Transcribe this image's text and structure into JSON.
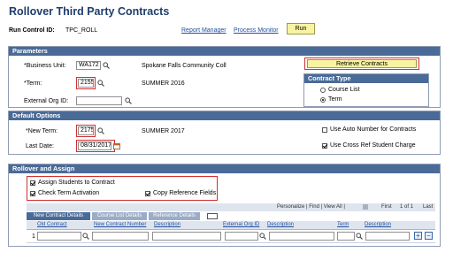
{
  "page": {
    "title": "Rollover Third Party Contracts",
    "run_control_label": "Run Control ID:",
    "run_control_value": "TPC_ROLL",
    "report_manager": "Report Manager",
    "process_monitor": "Process Monitor",
    "run_button": "Run"
  },
  "parameters": {
    "header": "Parameters",
    "business_unit_label": "*Business Unit:",
    "business_unit_value": "WA172",
    "business_unit_desc": "Spokane Falls Community Coll",
    "term_label": "*Term:",
    "term_value": "2155",
    "term_desc": "SUMMER 2016",
    "external_org_label": "External Org ID:",
    "external_org_value": "",
    "retrieve_button": "Retrieve Contracts",
    "contract_type": {
      "header": "Contract Type",
      "options": [
        "Course List",
        "Term"
      ],
      "selected": "Term"
    }
  },
  "default_options": {
    "header": "Default Options",
    "new_term_label": "*New Term:",
    "new_term_value": "2175",
    "new_term_desc": "SUMMER 2017",
    "last_date_label": "Last Date:",
    "last_date_value": "08/31/2017",
    "auto_number_label": "Use Auto Number for Contracts",
    "auto_number_checked": false,
    "cross_ref_label": "Use Cross Ref Student Charge",
    "cross_ref_checked": true
  },
  "rollover": {
    "header": "Rollover and Assign",
    "assign_students": "Assign Students to Contract",
    "assign_students_checked": true,
    "check_term": "Check Term Activation",
    "check_term_checked": true,
    "copy_reference": "Copy Reference Fields",
    "copy_reference_checked": true,
    "grid": {
      "toolbar": "Personalize | Find | View All |",
      "nav": "First",
      "range": "1 of 1",
      "last": "Last",
      "tabs": [
        "New Contract Details",
        "Course List Details",
        "Reference Details"
      ],
      "columns": [
        "Old Contract",
        "New Contract Number",
        "Description",
        "External Org ID",
        "Description",
        "Term",
        "Description"
      ],
      "rows": [
        {
          "num": "1",
          "old_contract": "",
          "new_contract": "",
          "description": "",
          "external_org": "",
          "description2": "",
          "term": "",
          "description3": ""
        }
      ]
    }
  }
}
